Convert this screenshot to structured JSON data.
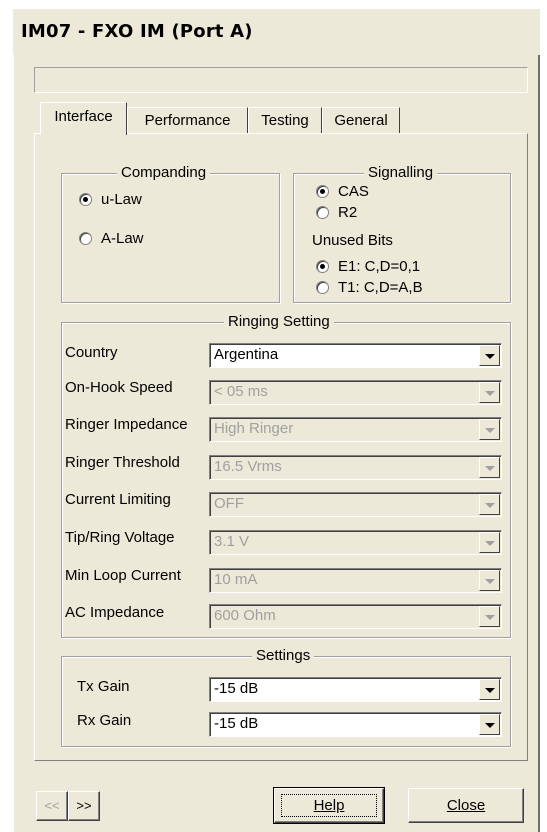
{
  "window": {
    "title": "IM07 - FXO IM (Port A)",
    "status": ""
  },
  "tabs": [
    {
      "label": "Interface",
      "active": true
    },
    {
      "label": "Performance",
      "active": false
    },
    {
      "label": "Testing",
      "active": false
    },
    {
      "label": "General",
      "active": false
    }
  ],
  "companding": {
    "title": "Companding",
    "options": [
      {
        "label": "u-Law",
        "selected": true
      },
      {
        "label": "A-Law",
        "selected": false
      }
    ]
  },
  "signalling": {
    "title": "Signalling",
    "options": [
      {
        "label": "CAS",
        "selected": true
      },
      {
        "label": "R2",
        "selected": false
      }
    ],
    "unused_bits_label": "Unused Bits",
    "unused_bits": [
      {
        "label": "E1: C,D=0,1",
        "selected": true
      },
      {
        "label": "T1: C,D=A,B",
        "selected": false
      }
    ]
  },
  "ringing": {
    "title": "Ringing Setting",
    "rows": [
      {
        "label": "Country",
        "value": "Argentina",
        "enabled": true
      },
      {
        "label": "On-Hook Speed",
        "value": "< 05 ms",
        "enabled": false
      },
      {
        "label": "Ringer Impedance",
        "value": "High Ringer",
        "enabled": false
      },
      {
        "label": "Ringer Threshold",
        "value": "16.5 Vrms",
        "enabled": false
      },
      {
        "label": "Current Limiting",
        "value": "OFF",
        "enabled": false
      },
      {
        "label": "Tip/Ring Voltage",
        "value": "3.1 V",
        "enabled": false
      },
      {
        "label": "Min Loop Current",
        "value": "10 mA",
        "enabled": false
      },
      {
        "label": "AC Impedance",
        "value": "600 Ohm",
        "enabled": false
      }
    ]
  },
  "settings": {
    "title": "Settings",
    "rows": [
      {
        "label": "Tx Gain",
        "value": "-15 dB"
      },
      {
        "label": "Rx Gain",
        "value": "-15 dB"
      }
    ]
  },
  "footer": {
    "prev_label": "<<",
    "next_label": ">>",
    "help_label": "Help",
    "close_label": "Close"
  }
}
